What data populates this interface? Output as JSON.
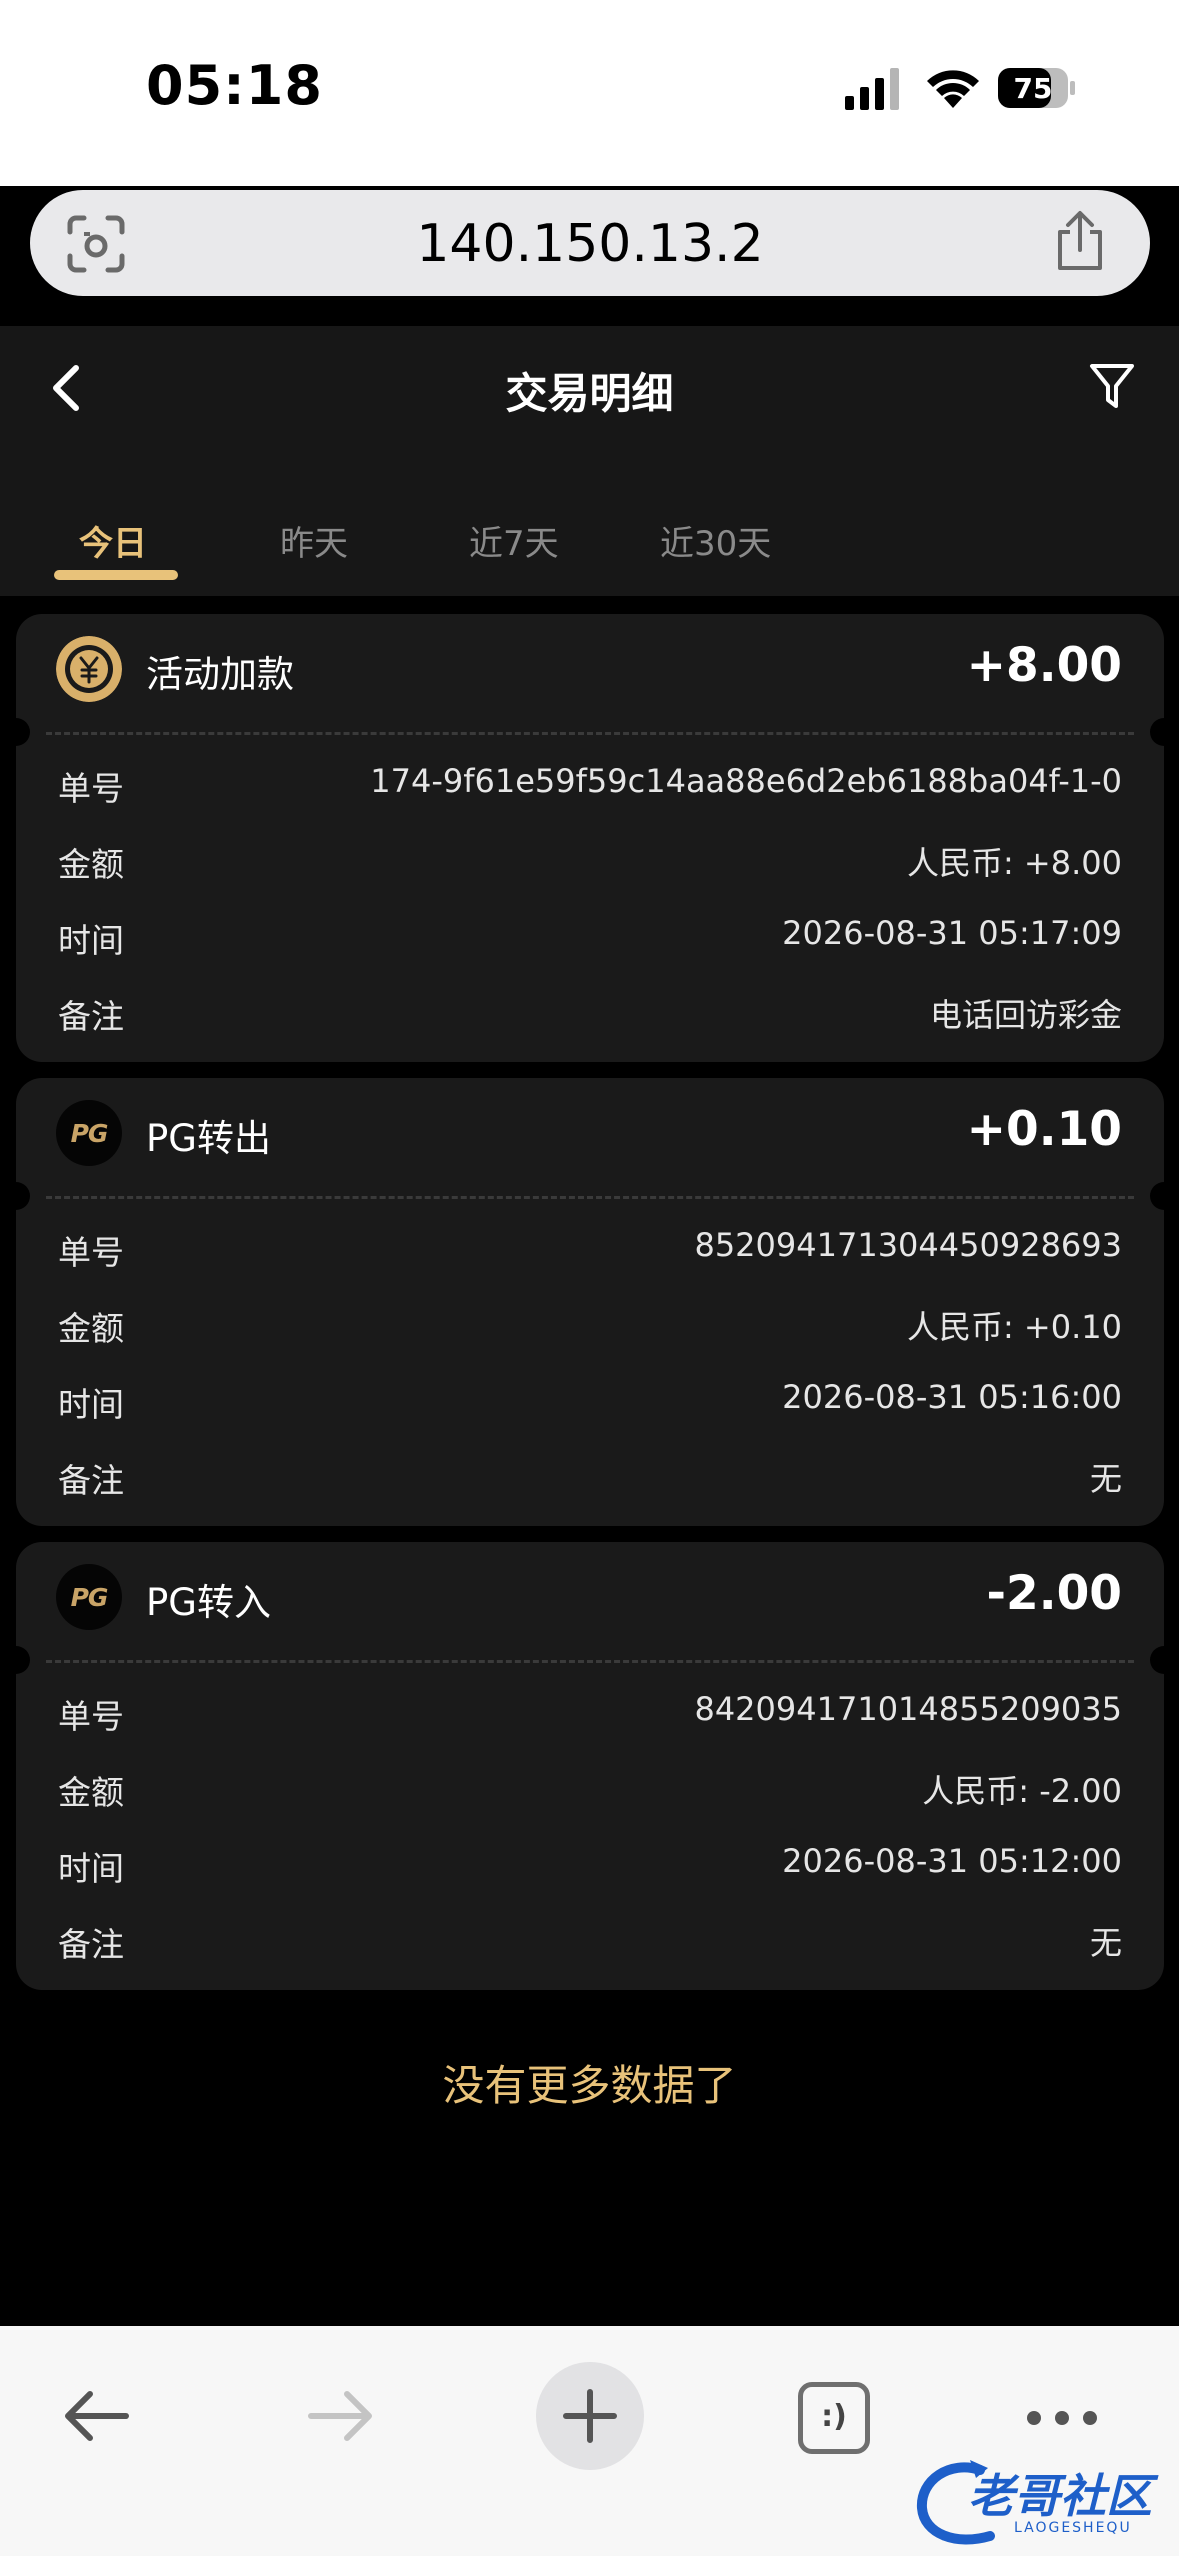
{
  "status": {
    "time": "05:18",
    "battery": "75"
  },
  "browser": {
    "url": "140.150.13.2"
  },
  "header": {
    "title": "交易明细"
  },
  "tabs": [
    {
      "label": "今日",
      "active": true
    },
    {
      "label": "昨天",
      "active": false
    },
    {
      "label": "近7天",
      "active": false
    },
    {
      "label": "近30天",
      "active": false
    }
  ],
  "field_labels": {
    "order": "单号",
    "amount": "金额",
    "time": "时间",
    "note": "备注"
  },
  "transactions": [
    {
      "icon": "coin-yen-icon",
      "name": "活动加款",
      "amount": "+8.00",
      "order": "174-9f61e59f59c14aa88e6d2eb6188ba04f-1-0",
      "amount_detail": "人民币: +8.00",
      "time": "2026-08-31 05:17:09",
      "note": "电话回访彩金"
    },
    {
      "icon": "pg-logo-icon",
      "name": "PG转出",
      "amount": "+0.10",
      "order": "852094171304450928693",
      "amount_detail": "人民币: +0.10",
      "time": "2026-08-31 05:16:00",
      "note": "无"
    },
    {
      "icon": "pg-logo-icon",
      "name": "PG转入",
      "amount": "-2.00",
      "order": "842094171014855209035",
      "amount_detail": "人民币: -2.00",
      "time": "2026-08-31 05:12:00",
      "note": "无"
    }
  ],
  "pg_logo_text": "PG",
  "footer_text": "没有更多数据了",
  "toolbar": {
    "tabs_glyph": ":)"
  },
  "watermark": {
    "text": "老哥社区",
    "sub": "LAOGESHEQU"
  },
  "colors": {
    "accent": "#e8c27a",
    "card_bg": "#1a1a1a",
    "header_bg": "#171717"
  }
}
